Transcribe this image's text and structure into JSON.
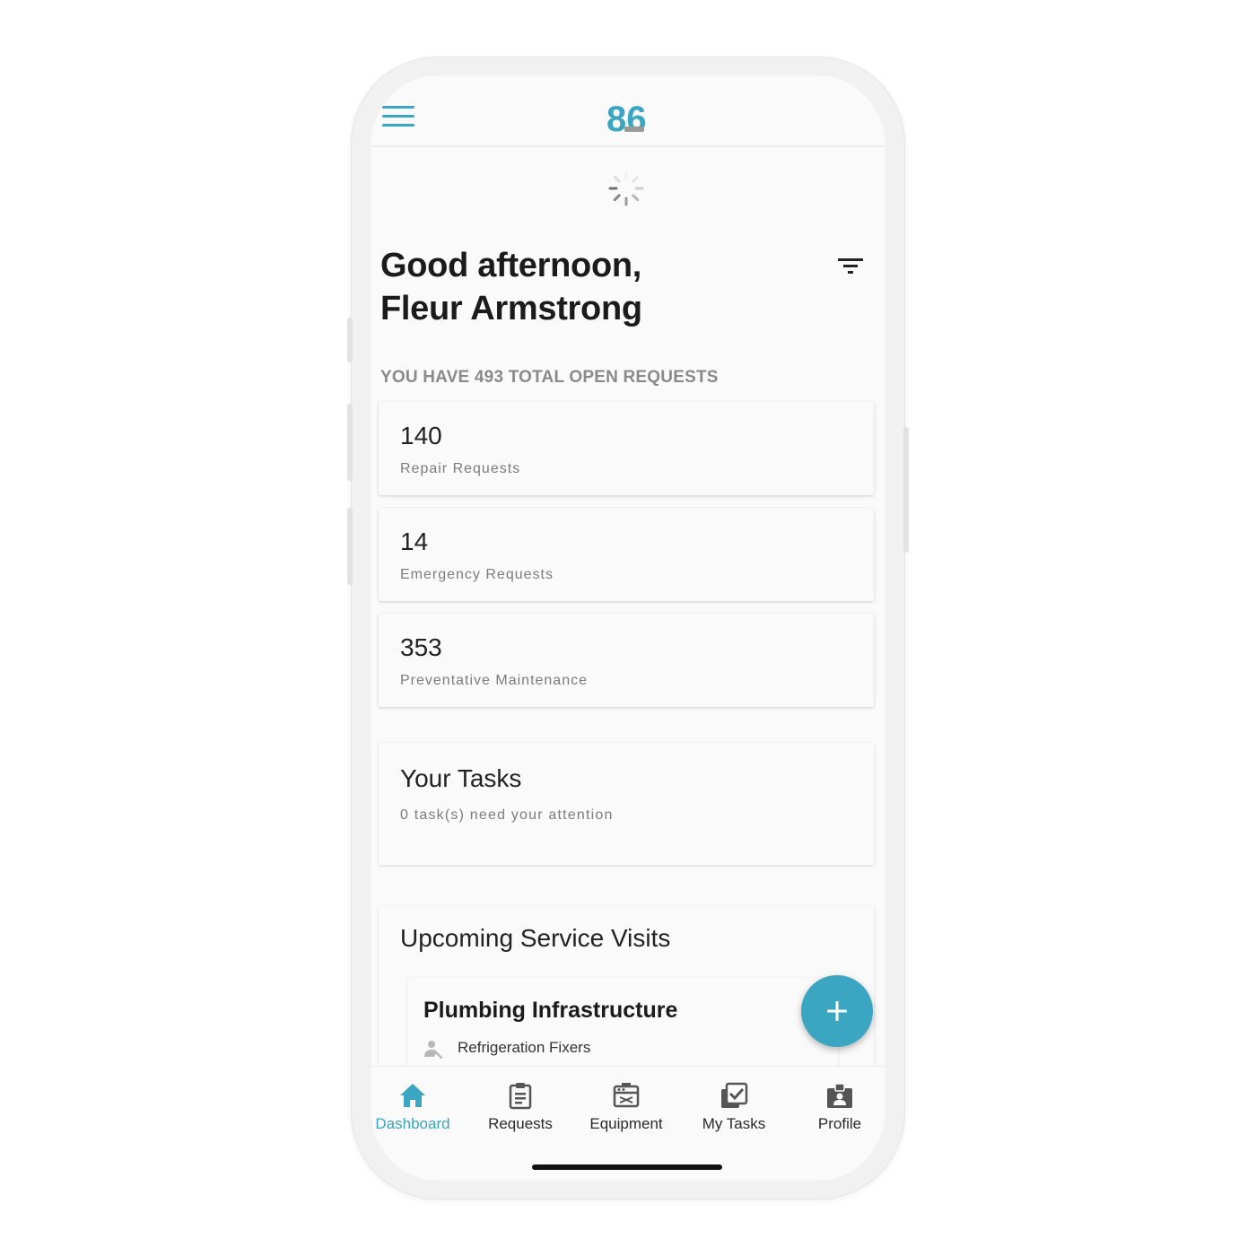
{
  "app": {
    "logo_text": "86",
    "accent_color": "#3aa6c2"
  },
  "header": {
    "menu_icon": "hamburger-menu-icon",
    "logo_icon": "app-logo-icon",
    "spinner_icon": "loading-spinner-icon"
  },
  "greeting": {
    "line1": "Good afternoon,",
    "line2": "Fleur Armstrong",
    "filter_icon": "filter-icon"
  },
  "summary": {
    "open_requests_text": "YOU HAVE 493 TOTAL OPEN REQUESTS"
  },
  "stats": [
    {
      "value": "140",
      "label": "Repair Requests"
    },
    {
      "value": "14",
      "label": "Emergency Requests"
    },
    {
      "value": "353",
      "label": "Preventative Maintenance"
    }
  ],
  "tasks": {
    "title": "Your Tasks",
    "subtitle": "0 task(s) need your attention"
  },
  "visits": {
    "title": "Upcoming Service Visits",
    "items": [
      {
        "title": "Plumbing Infrastructure",
        "vendor": "Refrigeration Fixers",
        "icon": "person-wrench-icon"
      }
    ]
  },
  "fab": {
    "icon": "plus-icon"
  },
  "tabbar": {
    "tabs": [
      {
        "label": "Dashboard",
        "icon": "home-icon",
        "active": true
      },
      {
        "label": "Requests",
        "icon": "clipboard-icon",
        "active": false
      },
      {
        "label": "Equipment",
        "icon": "equipment-icon",
        "active": false
      },
      {
        "label": "My Tasks",
        "icon": "checklist-icon",
        "active": false
      },
      {
        "label": "Profile",
        "icon": "badge-icon",
        "active": false
      }
    ]
  }
}
